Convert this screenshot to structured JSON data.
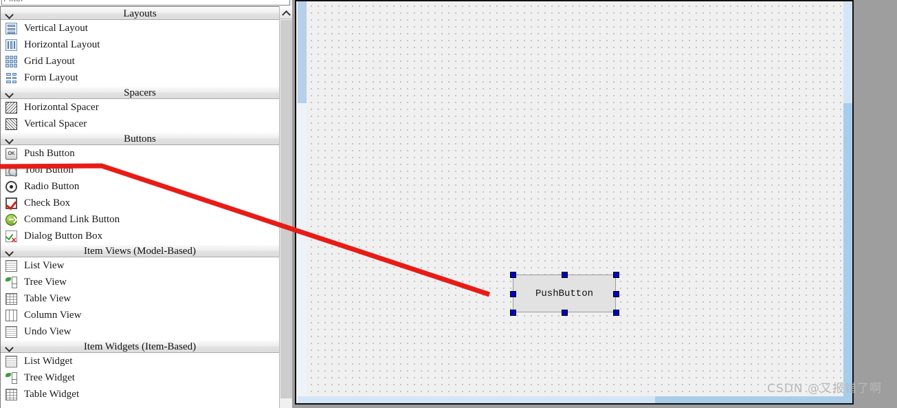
{
  "filter": {
    "value": "",
    "placeholder": "Filter"
  },
  "widget_box": {
    "groups": [
      {
        "title": "Layouts",
        "items": [
          {
            "label": "Vertical Layout",
            "icon": "vertical-layout-icon"
          },
          {
            "label": "Horizontal Layout",
            "icon": "horizontal-layout-icon"
          },
          {
            "label": "Grid Layout",
            "icon": "grid-layout-icon"
          },
          {
            "label": "Form Layout",
            "icon": "form-layout-icon"
          }
        ]
      },
      {
        "title": "Spacers",
        "items": [
          {
            "label": "Horizontal Spacer",
            "icon": "horizontal-spacer-icon"
          },
          {
            "label": "Vertical Spacer",
            "icon": "vertical-spacer-icon"
          }
        ]
      },
      {
        "title": "Buttons",
        "items": [
          {
            "label": "Push Button",
            "icon": "push-button-icon"
          },
          {
            "label": "Tool Button",
            "icon": "tool-button-icon"
          },
          {
            "label": "Radio Button",
            "icon": "radio-button-icon"
          },
          {
            "label": "Check Box",
            "icon": "check-box-icon"
          },
          {
            "label": "Command Link Button",
            "icon": "command-link-button-icon"
          },
          {
            "label": "Dialog Button Box",
            "icon": "dialog-button-box-icon"
          }
        ]
      },
      {
        "title": "Item Views (Model-Based)",
        "items": [
          {
            "label": "List View",
            "icon": "list-view-icon"
          },
          {
            "label": "Tree View",
            "icon": "tree-view-icon"
          },
          {
            "label": "Table View",
            "icon": "table-view-icon"
          },
          {
            "label": "Column View",
            "icon": "column-view-icon"
          },
          {
            "label": "Undo View",
            "icon": "undo-view-icon"
          }
        ]
      },
      {
        "title": "Item Widgets (Item-Based)",
        "items": [
          {
            "label": "List Widget",
            "icon": "list-widget-icon"
          },
          {
            "label": "Tree Widget",
            "icon": "tree-widget-icon"
          },
          {
            "label": "Table Widget",
            "icon": "table-widget-icon"
          }
        ]
      }
    ]
  },
  "canvas": {
    "selected_widget": {
      "text": "PushButton",
      "selected": true,
      "handle_count": 8
    }
  },
  "annotation": {
    "color": "#e81b16",
    "from_label": "Push Button",
    "to_label": "PushButton"
  },
  "watermark": {
    "text": "CSDN @又报错了啊"
  },
  "colors": {
    "accent": "#0000c8",
    "annotation": "#e81b16",
    "canvas_bg": "#f0f0f0",
    "scrollbar": "#a8cdeb"
  }
}
